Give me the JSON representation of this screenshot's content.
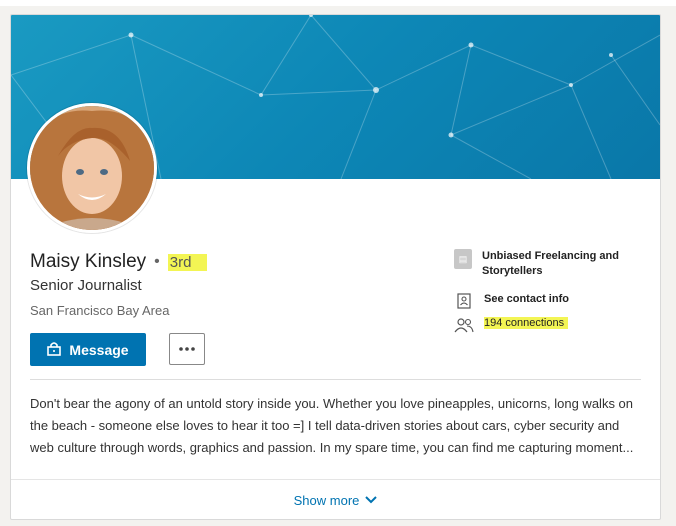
{
  "profile": {
    "name": "Maisy Kinsley",
    "degree": "3rd",
    "headline": "Senior Journalist",
    "location": "San Francisco Bay Area",
    "summary": "Don't bear the agony of an untold story inside you. Whether you love pineapples, unicorns, long walks on the beach - someone else loves to hear it too =] I tell data-driven stories about cars, cyber security and web culture through words, graphics and passion. In my spare time, you can find me capturing moment..."
  },
  "actions": {
    "message_label": "Message",
    "more_label": "..."
  },
  "info": {
    "company": "Unbiased Freelancing and Storytellers",
    "contact": "See contact info",
    "connections": "194 connections"
  },
  "footer": {
    "show_more": "Show more"
  },
  "colors": {
    "brand": "#0073b1",
    "highlight": "#f3f554",
    "banner": "#1a9ac2"
  },
  "icons": [
    "company-icon",
    "contact-card-icon",
    "people-icon",
    "lock-icon",
    "chevron-down-icon"
  ]
}
